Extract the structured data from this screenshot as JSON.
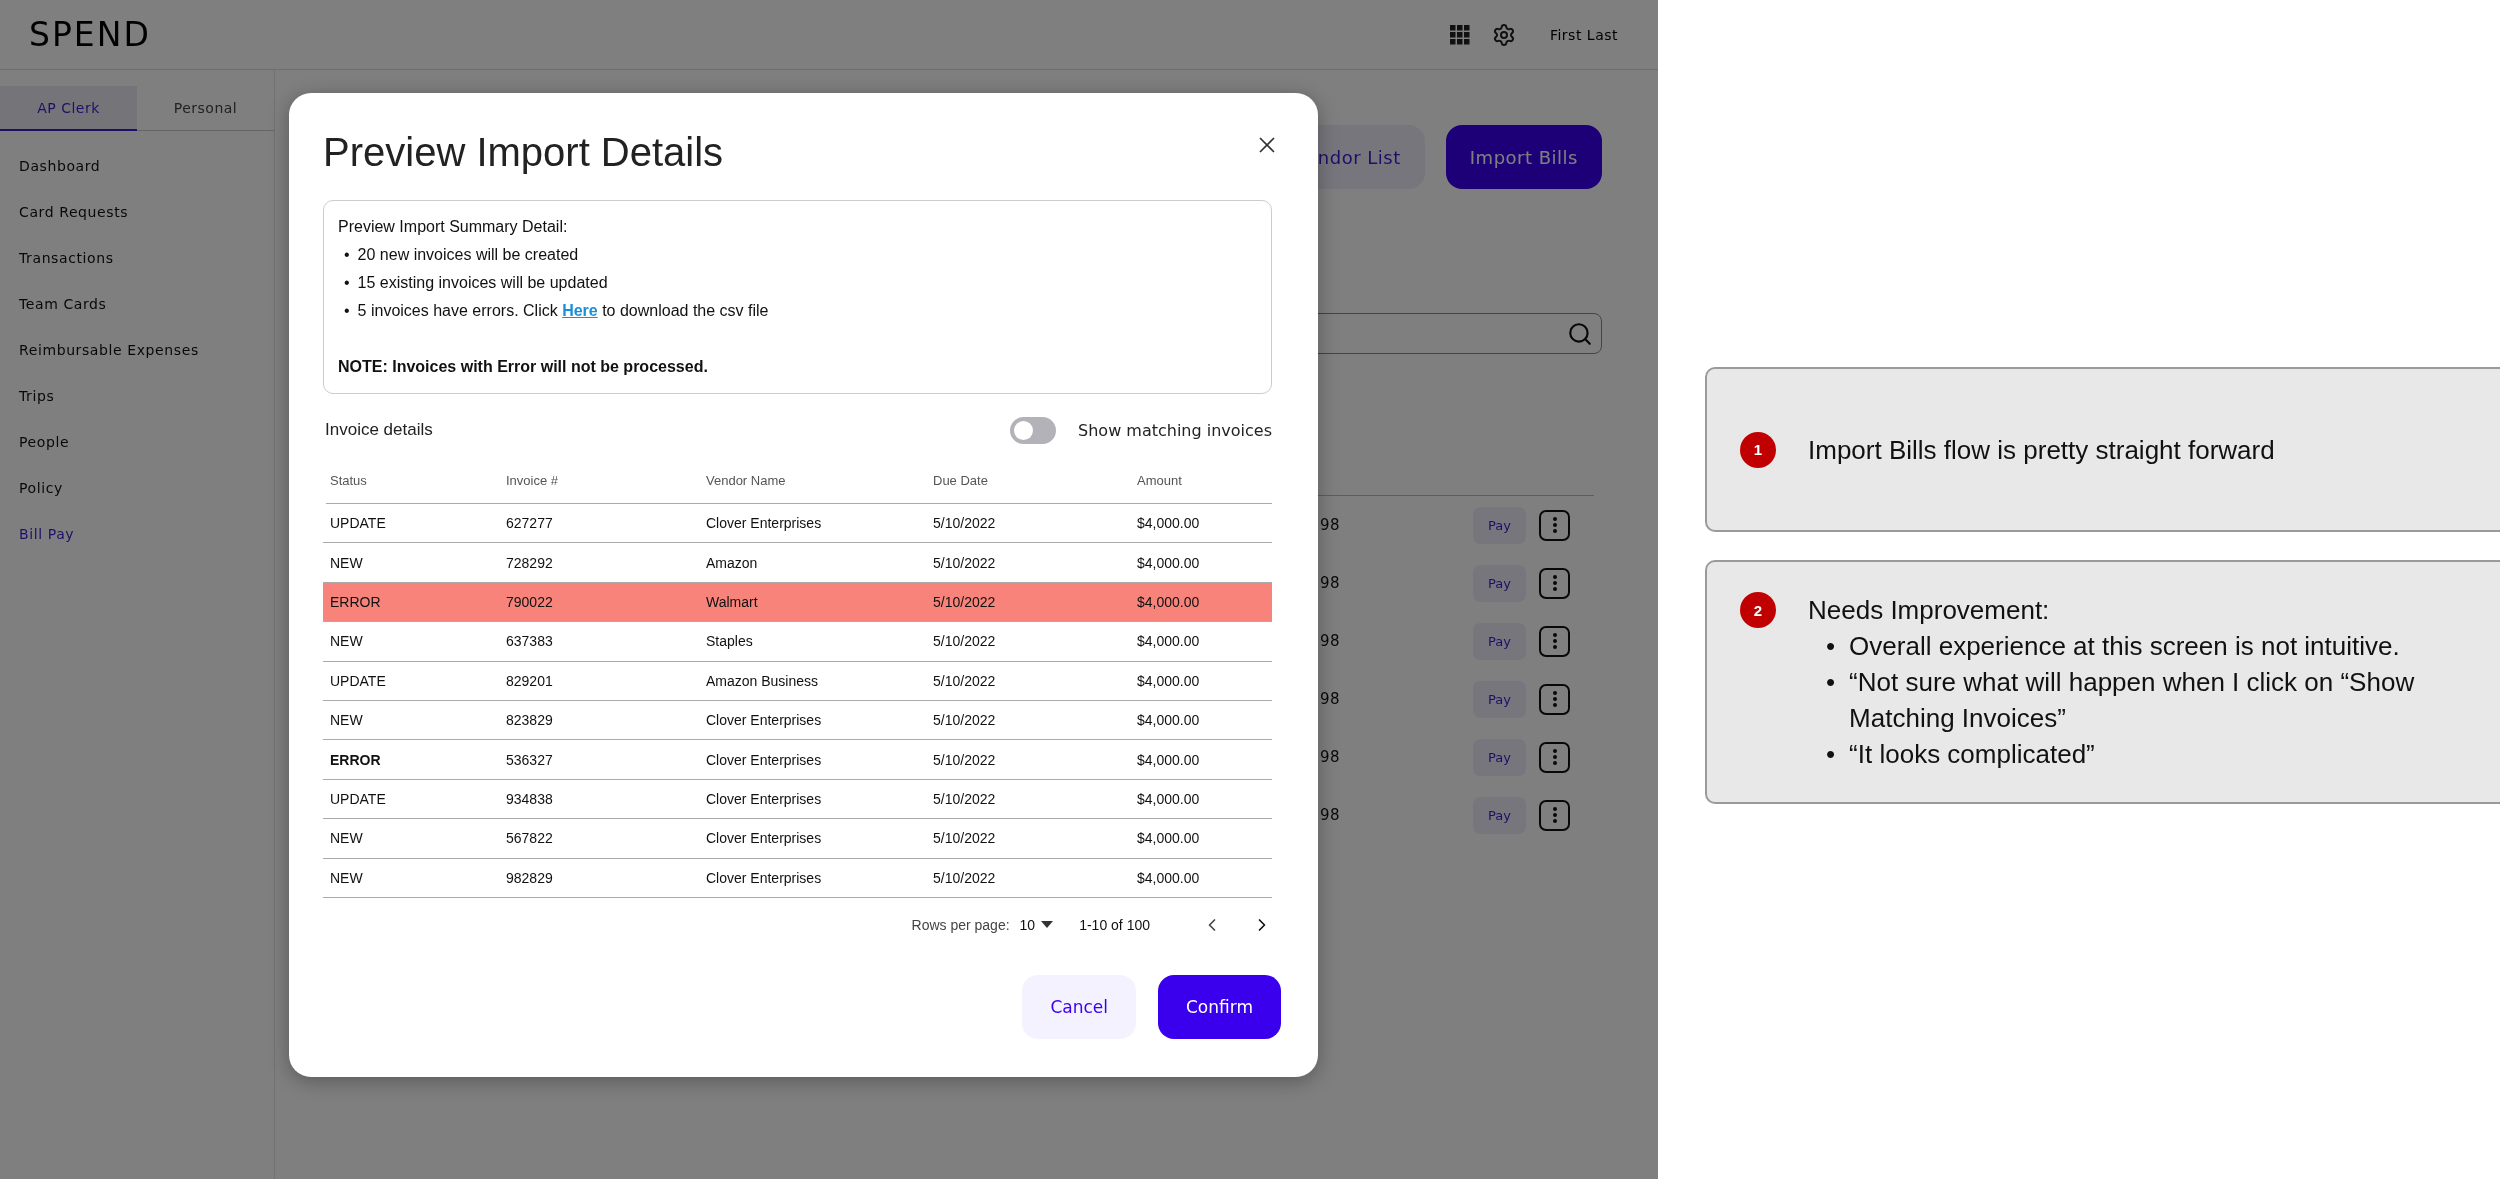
{
  "app": {
    "logo": "SPEND",
    "user": "First Last"
  },
  "sidebar": {
    "tabs": [
      {
        "label": "AP Clerk",
        "selected": true
      },
      {
        "label": "Personal",
        "selected": false
      }
    ],
    "items": [
      {
        "label": "Dashboard",
        "selected": false
      },
      {
        "label": "Card Requests",
        "selected": false
      },
      {
        "label": "Transactions",
        "selected": false
      },
      {
        "label": "Team Cards",
        "selected": false
      },
      {
        "label": "Reimbursable Expenses",
        "selected": false
      },
      {
        "label": "Trips",
        "selected": false
      },
      {
        "label": "People",
        "selected": false
      },
      {
        "label": "Policy",
        "selected": false
      },
      {
        "label": "Bill Pay",
        "selected": true
      }
    ]
  },
  "main": {
    "buttons": [
      {
        "label": "ndor List",
        "kind": "secondary"
      },
      {
        "label": "Import Bills",
        "kind": "primary"
      }
    ],
    "rows": [
      {
        "column_1": "98",
        "action": "Pay"
      },
      {
        "column_1": "98",
        "action": "Pay"
      },
      {
        "column_1": "98",
        "action": "Pay"
      },
      {
        "column_1": "98",
        "action": "Pay"
      },
      {
        "column_1": "98",
        "action": "Pay"
      },
      {
        "column_1": "98",
        "action": "Pay"
      }
    ]
  },
  "modal": {
    "title": "Preview Import Details",
    "summary": {
      "heading": "Preview Import Summary Detail:",
      "marker": "•",
      "bullets": [
        {
          "text": "20 new invoices will be created"
        },
        {
          "text": "15 existing invoices will be updated"
        },
        {
          "text": "5 invoices have errors. Click",
          "link": "Here",
          "after": "to download the csv file"
        }
      ],
      "note": "NOTE: Invoices with Error will not be processed."
    },
    "section_label": "Invoice details",
    "toggle": {
      "label": "Show matching invoices",
      "on": false
    },
    "table": {
      "columns": [
        "Status",
        "Invoice #",
        "Vendor Name",
        "Due Date",
        "Amount"
      ],
      "rows": [
        {
          "status": "UPDATE",
          "invoice": "627277",
          "vendor": "Clover Enterprises",
          "due_date": "5/10/2022",
          "amount": "$4,000.00",
          "highlighted": false,
          "emphasized": false
        },
        {
          "status": "NEW",
          "invoice": "728292",
          "vendor": "Amazon",
          "due_date": "5/10/2022",
          "amount": "$4,000.00",
          "highlighted": false,
          "emphasized": false
        },
        {
          "status": "ERROR",
          "invoice": "790022",
          "vendor": "Walmart",
          "due_date": "5/10/2022",
          "amount": "$4,000.00",
          "highlighted": true,
          "emphasized": false
        },
        {
          "status": "NEW",
          "invoice": "637383",
          "vendor": "Staples",
          "due_date": "5/10/2022",
          "amount": "$4,000.00",
          "highlighted": false,
          "emphasized": false
        },
        {
          "status": "UPDATE",
          "invoice": "829201",
          "vendor": "Amazon Business",
          "due_date": "5/10/2022",
          "amount": "$4,000.00",
          "highlighted": false,
          "emphasized": false
        },
        {
          "status": "NEW",
          "invoice": "823829",
          "vendor": "Clover Enterprises",
          "due_date": "5/10/2022",
          "amount": "$4,000.00",
          "highlighted": false,
          "emphasized": false
        },
        {
          "status": "ERROR",
          "invoice": "536327",
          "vendor": "Clover Enterprises",
          "due_date": "5/10/2022",
          "amount": "$4,000.00",
          "highlighted": false,
          "emphasized": true
        },
        {
          "status": "UPDATE",
          "invoice": "934838",
          "vendor": "Clover Enterprises",
          "due_date": "5/10/2022",
          "amount": "$4,000.00",
          "highlighted": false,
          "emphasized": false
        },
        {
          "status": "NEW",
          "invoice": "567822",
          "vendor": "Clover Enterprises",
          "due_date": "5/10/2022",
          "amount": "$4,000.00",
          "highlighted": false,
          "emphasized": false
        },
        {
          "status": "NEW",
          "invoice": "982829",
          "vendor": "Clover Enterprises",
          "due_date": "5/10/2022",
          "amount": "$4,000.00",
          "highlighted": false,
          "emphasized": false
        }
      ]
    },
    "pagination": {
      "rows_per_page_label": "Rows per page:",
      "rows_per_page": "10",
      "range": "1-10 of 100"
    },
    "buttons": [
      {
        "label": "Cancel",
        "kind": "secondary"
      },
      {
        "label": "Confirm",
        "kind": "primary"
      }
    ]
  },
  "notes": [
    {
      "number": "1",
      "text": "Import Bills flow is pretty straight forward"
    },
    {
      "number": "2",
      "text": "Needs Improvement:",
      "marker": "•",
      "bullets": [
        "Overall experience at this screen is not intuitive.",
        "“Not sure what will happen when I click on “Show Matching Invoices”",
        "“It looks complicated”"
      ]
    }
  ]
}
